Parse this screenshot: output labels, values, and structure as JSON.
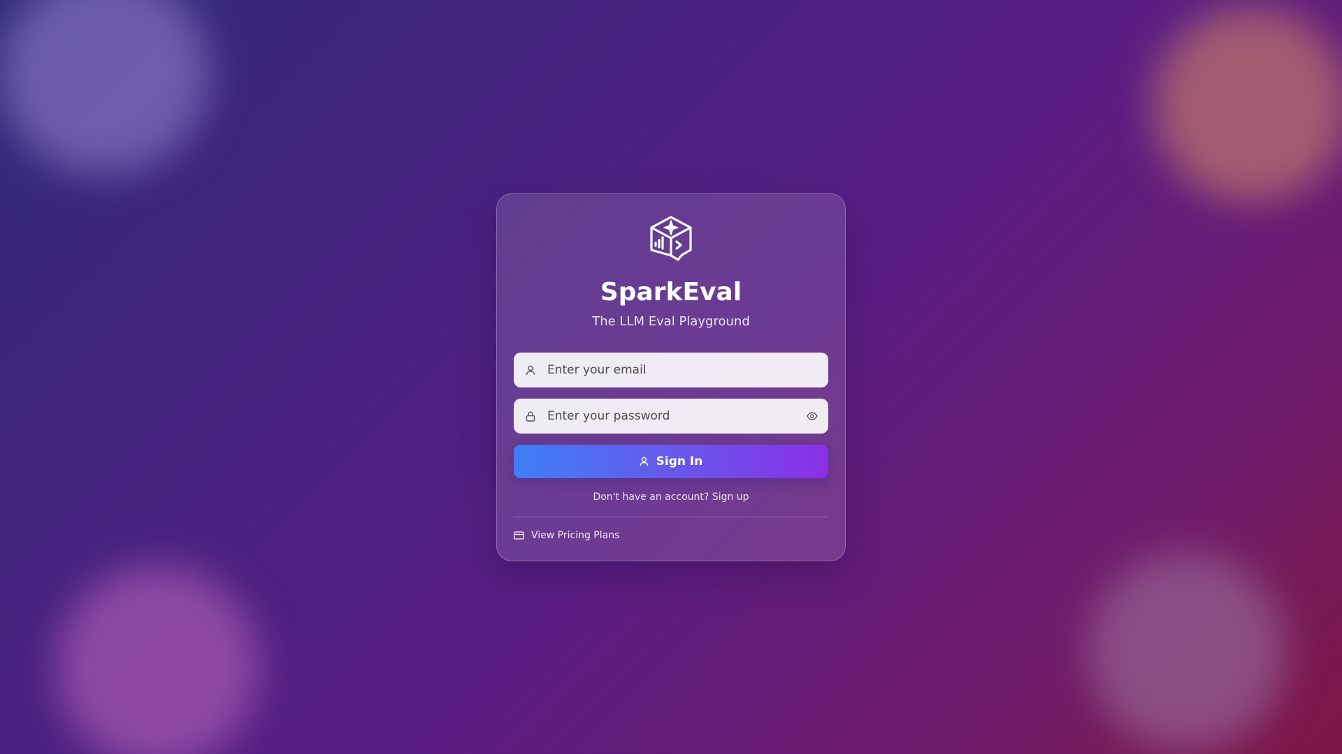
{
  "app": {
    "name": "SparkEval",
    "tagline": "The LLM Eval Playground",
    "logo_icon": "cube-sparkle-chart-icon"
  },
  "form": {
    "email": {
      "placeholder": "Enter your email",
      "value": "",
      "icon": "user-icon"
    },
    "password": {
      "placeholder": "Enter your password",
      "value": "",
      "icon": "lock-icon",
      "toggle_icon": "eye-icon"
    },
    "submit": {
      "label": "Sign In",
      "icon": "user-icon"
    }
  },
  "signup": {
    "prompt": "Don't have an account?",
    "link_label": "Sign up"
  },
  "pricing": {
    "label": "View Pricing Plans",
    "icon": "credit-card-icon"
  },
  "colors": {
    "button_gradient_start": "#3f7ff5",
    "button_gradient_end": "#8b2fe6",
    "background_start": "#2f2b7a",
    "background_end": "#7e1745"
  }
}
